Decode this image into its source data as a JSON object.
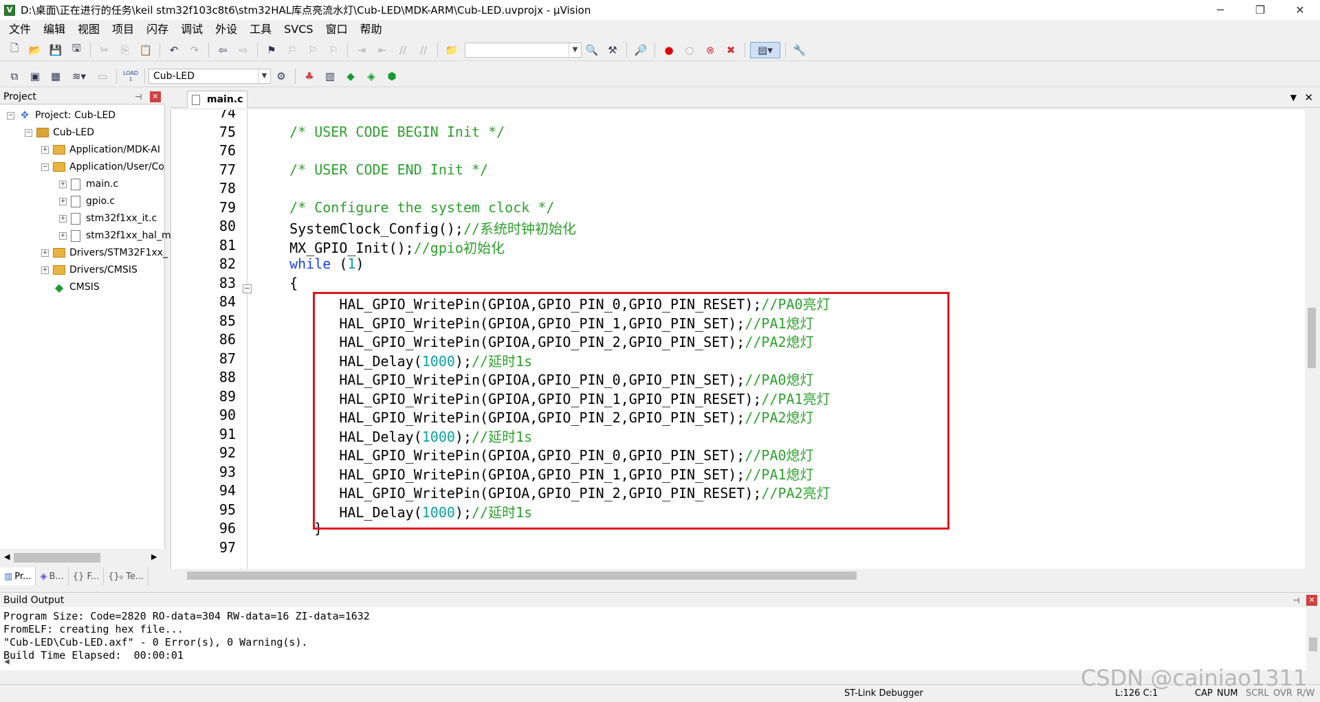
{
  "window": {
    "title": "D:\\桌面\\正在进行的任务\\keil stm32f103c8t6\\stm32HAL库点亮流水灯\\Cub-LED\\MDK-ARM\\Cub-LED.uvprojx - µVision",
    "icon_letter": "V",
    "minimize_glyph": "─",
    "restore_glyph": "❐",
    "close_glyph": "✕"
  },
  "menu": [
    "文件",
    "编辑",
    "视图",
    "项目",
    "闪存",
    "调试",
    "外设",
    "工具",
    "SVCS",
    "窗口",
    "帮助"
  ],
  "toolbar2": {
    "target": "Cub-LED",
    "load_label": "LOAD"
  },
  "project_panel": {
    "title": "Project",
    "pin_glyph": "📌",
    "close_glyph": "✕",
    "tree": [
      {
        "label": "Project: Cub-LED",
        "type": "project",
        "expander": "−"
      },
      {
        "label": "Cub-LED",
        "type": "target",
        "expander": "−"
      },
      {
        "label": "Application/MDK-AI",
        "type": "folder",
        "expander": "+"
      },
      {
        "label": "Application/User/Co",
        "type": "folder",
        "expander": "−"
      },
      {
        "label": "main.c",
        "type": "file",
        "expander": "+"
      },
      {
        "label": "gpio.c",
        "type": "file",
        "expander": "+"
      },
      {
        "label": "stm32f1xx_it.c",
        "type": "file",
        "expander": "+"
      },
      {
        "label": "stm32f1xx_hal_m",
        "type": "file",
        "expander": "+"
      },
      {
        "label": "Drivers/STM32F1xx_",
        "type": "folder",
        "expander": "+"
      },
      {
        "label": "Drivers/CMSIS",
        "type": "folder",
        "expander": "+"
      },
      {
        "label": "CMSIS",
        "type": "component",
        "expander": ""
      }
    ],
    "tabs": [
      "Pr...",
      "B...",
      "{} F...",
      "{}₀ Te..."
    ]
  },
  "editor": {
    "tab_label": "main.c",
    "lines": [
      {
        "n": "74",
        "parts": []
      },
      {
        "n": "75",
        "parts": [
          {
            "t": "  /* USER CODE BEGIN Init */",
            "c": "comment"
          }
        ]
      },
      {
        "n": "76",
        "parts": []
      },
      {
        "n": "77",
        "parts": [
          {
            "t": "  /* USER CODE END Init */",
            "c": "comment"
          }
        ]
      },
      {
        "n": "78",
        "parts": []
      },
      {
        "n": "79",
        "parts": [
          {
            "t": "  /* Configure the system clock */",
            "c": "comment"
          }
        ]
      },
      {
        "n": "80",
        "parts": [
          {
            "t": "  SystemClock_Config();",
            "c": ""
          },
          {
            "t": "//系统时钟初始化",
            "c": "comment"
          }
        ]
      },
      {
        "n": "81",
        "parts": [
          {
            "t": "  MX_GPIO_Init();",
            "c": ""
          },
          {
            "t": "//gpio初始化",
            "c": "comment"
          }
        ]
      },
      {
        "n": "82",
        "parts": [
          {
            "t": "  ",
            "c": ""
          },
          {
            "t": "while",
            "c": "kw"
          },
          {
            "t": " (",
            "c": ""
          },
          {
            "t": "1",
            "c": "num"
          },
          {
            "t": ")",
            "c": ""
          }
        ]
      },
      {
        "n": "83",
        "parts": [
          {
            "t": "  {",
            "c": ""
          }
        ]
      },
      {
        "n": "84",
        "parts": [
          {
            "t": "        HAL_GPIO_WritePin(GPIOA,GPIO_PIN_0,GPIO_PIN_RESET);",
            "c": ""
          },
          {
            "t": "//PA0亮灯",
            "c": "comment"
          }
        ]
      },
      {
        "n": "85",
        "parts": [
          {
            "t": "        HAL_GPIO_WritePin(GPIOA,GPIO_PIN_1,GPIO_PIN_SET);",
            "c": ""
          },
          {
            "t": "//PA1熄灯",
            "c": "comment"
          }
        ]
      },
      {
        "n": "86",
        "parts": [
          {
            "t": "        HAL_GPIO_WritePin(GPIOA,GPIO_PIN_2,GPIO_PIN_SET);",
            "c": ""
          },
          {
            "t": "//PA2熄灯",
            "c": "comment"
          }
        ]
      },
      {
        "n": "87",
        "parts": [
          {
            "t": "        HAL_Delay(",
            "c": ""
          },
          {
            "t": "1000",
            "c": "num"
          },
          {
            "t": ");",
            "c": ""
          },
          {
            "t": "//延时1s",
            "c": "comment"
          }
        ]
      },
      {
        "n": "88",
        "parts": [
          {
            "t": "        HAL_GPIO_WritePin(GPIOA,GPIO_PIN_0,GPIO_PIN_SET);",
            "c": ""
          },
          {
            "t": "//PA0熄灯",
            "c": "comment"
          }
        ]
      },
      {
        "n": "89",
        "parts": [
          {
            "t": "        HAL_GPIO_WritePin(GPIOA,GPIO_PIN_1,GPIO_PIN_RESET);",
            "c": ""
          },
          {
            "t": "//PA1亮灯",
            "c": "comment"
          }
        ]
      },
      {
        "n": "90",
        "parts": [
          {
            "t": "        HAL_GPIO_WritePin(GPIOA,GPIO_PIN_2,GPIO_PIN_SET);",
            "c": ""
          },
          {
            "t": "//PA2熄灯",
            "c": "comment"
          }
        ]
      },
      {
        "n": "91",
        "parts": [
          {
            "t": "        HAL_Delay(",
            "c": ""
          },
          {
            "t": "1000",
            "c": "num"
          },
          {
            "t": ");",
            "c": ""
          },
          {
            "t": "//延时1s",
            "c": "comment"
          }
        ]
      },
      {
        "n": "92",
        "parts": [
          {
            "t": "        HAL_GPIO_WritePin(GPIOA,GPIO_PIN_0,GPIO_PIN_SET);",
            "c": ""
          },
          {
            "t": "//PA0熄灯",
            "c": "comment"
          }
        ]
      },
      {
        "n": "93",
        "parts": [
          {
            "t": "        HAL_GPIO_WritePin(GPIOA,GPIO_PIN_1,GPIO_PIN_SET);",
            "c": ""
          },
          {
            "t": "//PA1熄灯",
            "c": "comment"
          }
        ]
      },
      {
        "n": "94",
        "parts": [
          {
            "t": "        HAL_GPIO_WritePin(GPIOA,GPIO_PIN_2,GPIO_PIN_RESET);",
            "c": ""
          },
          {
            "t": "//PA2亮灯",
            "c": "comment"
          }
        ]
      },
      {
        "n": "95",
        "parts": [
          {
            "t": "        HAL_Delay(",
            "c": ""
          },
          {
            "t": "1000",
            "c": "num"
          },
          {
            "t": ");",
            "c": ""
          },
          {
            "t": "//延时1s",
            "c": "comment"
          }
        ]
      },
      {
        "n": "96",
        "parts": [
          {
            "t": "     }",
            "c": ""
          }
        ]
      },
      {
        "n": "97",
        "parts": []
      }
    ]
  },
  "build_output": {
    "title": "Build Output",
    "lines": [
      "Program Size: Code=2820 RO-data=304 RW-data=16 ZI-data=1632",
      "FromELF: creating hex file...",
      "\"Cub-LED\\Cub-LED.axf\" - 0 Error(s), 0 Warning(s).",
      "Build Time Elapsed:  00:00:01"
    ]
  },
  "status": {
    "debugger": "ST-Link Debugger",
    "position": "L:126 C:1",
    "caps": "CAP",
    "num": "NUM",
    "scrl": "SCRL",
    "ovr": "OVR",
    "rw": "R/W"
  },
  "watermark": "CSDN @cainiao1311",
  "colors": {
    "comment": "#2ea02e",
    "keyword": "#1a3fff",
    "number": "#0aa0a0",
    "highlight_border": "#e0141e"
  }
}
